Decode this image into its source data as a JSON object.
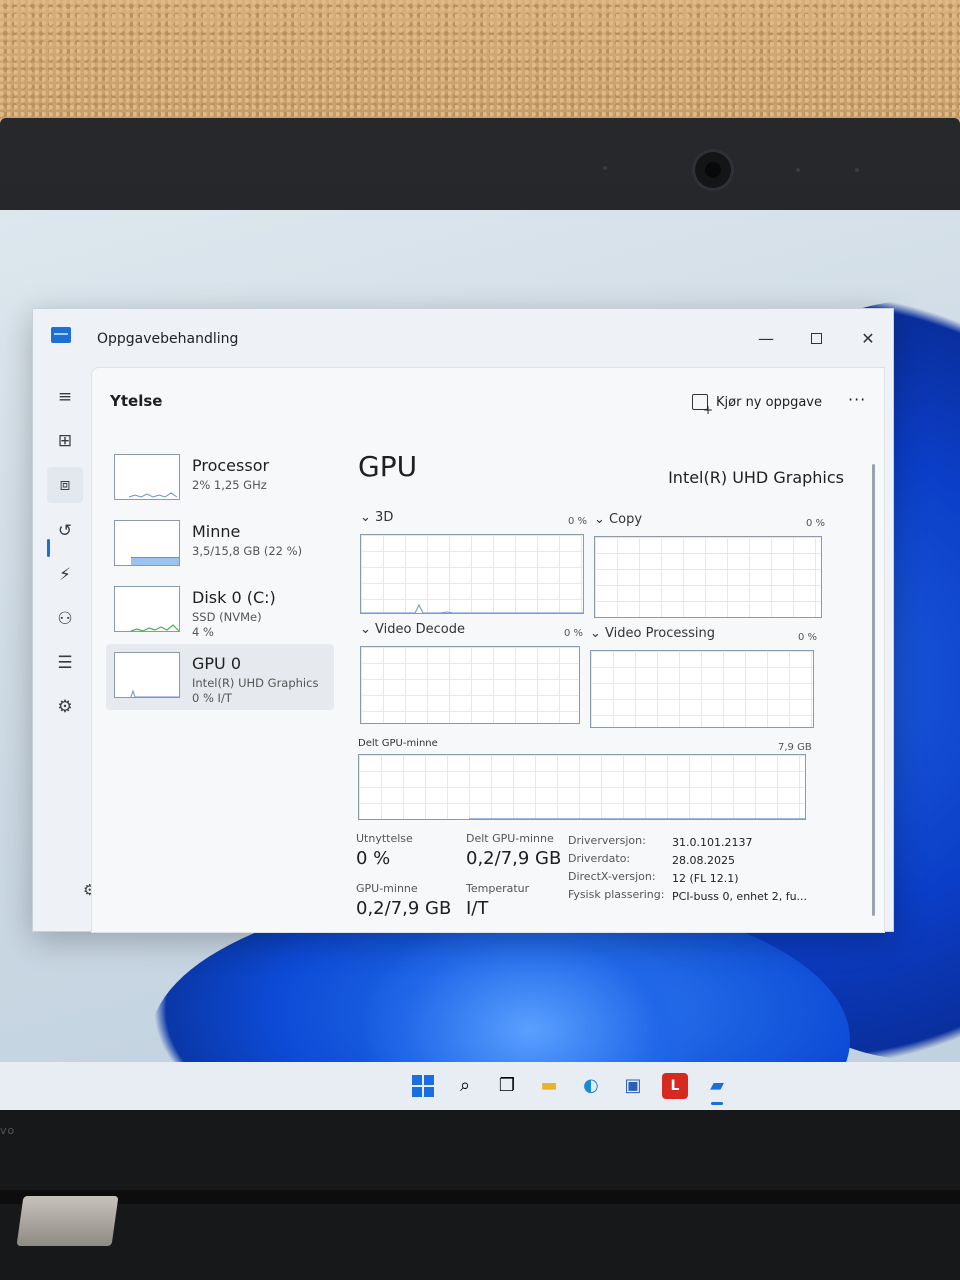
{
  "window": {
    "title": "Oppgavebehandling",
    "minimize_glyph": "—",
    "close_glyph": "✕"
  },
  "header": {
    "section_title": "Ytelse",
    "run_task_label": "Kjør ny oppgave",
    "more_glyph": "···"
  },
  "nav": {
    "menu": "≡",
    "processes": "⊞",
    "performance": "⧈",
    "history": "↺",
    "startup": "⚡",
    "users": "⚇",
    "details": "☰",
    "services": "⚙",
    "settings": "⚙"
  },
  "devices": [
    {
      "name": "Processor",
      "sub1": "2% 1,25 GHz",
      "sub2": ""
    },
    {
      "name": "Minne",
      "sub1": "3,5/15,8 GB (22 %)",
      "sub2": ""
    },
    {
      "name": "Disk 0 (C:)",
      "sub1": "SSD (NVMe)",
      "sub2": "4 %"
    },
    {
      "name": "GPU 0",
      "sub1": "Intel(R) UHD Graphics",
      "sub2": "0 % I/T"
    }
  ],
  "detail": {
    "title": "GPU",
    "model": "Intel(R) UHD Graphics",
    "graphs": [
      {
        "label": "3D",
        "pct": "0 %"
      },
      {
        "label": "Copy",
        "pct": "0 %"
      },
      {
        "label": "Video Decode",
        "pct": "0 %"
      },
      {
        "label": "Video Processing",
        "pct": "0 %"
      }
    ],
    "shared_memory": {
      "label": "Delt GPU-minne",
      "max": "7,9 GB"
    },
    "chevron": "⌄"
  },
  "stats": {
    "utilization_label": "Utnyttelse",
    "utilization_value": "0 %",
    "shared_gpu_mem_label": "Delt GPU-minne",
    "shared_gpu_mem_value": "0,2/7,9 GB",
    "gpu_mem_label": "GPU-minne",
    "gpu_mem_value": "0,2/7,9 GB",
    "temperature_label": "Temperatur",
    "temperature_value": "I/T",
    "driver_version_key": "Driverversjon:",
    "driver_version_val": "31.0.101.2137",
    "driver_date_key": "Driverdato:",
    "driver_date_val": "28.08.2025",
    "directx_key": "DirectX-versjon:",
    "directx_val": "12 (FL 12.1)",
    "location_key": "Fysisk plassering:",
    "location_val": "PCI-buss 0, enhet 2, fu..."
  },
  "taskbar": {
    "search": "⌕",
    "taskview": "❐",
    "explorer": "▬",
    "edge": "◐",
    "store": "▣",
    "app_l": "L",
    "taskmgr": "▰"
  },
  "bezel": {
    "brand": "vo"
  },
  "colors": {
    "accent": "#1a6fd6",
    "graph_line": "#6b8fd6",
    "disk_line": "#4caf50",
    "memory_fill": "#9cc2ee"
  }
}
